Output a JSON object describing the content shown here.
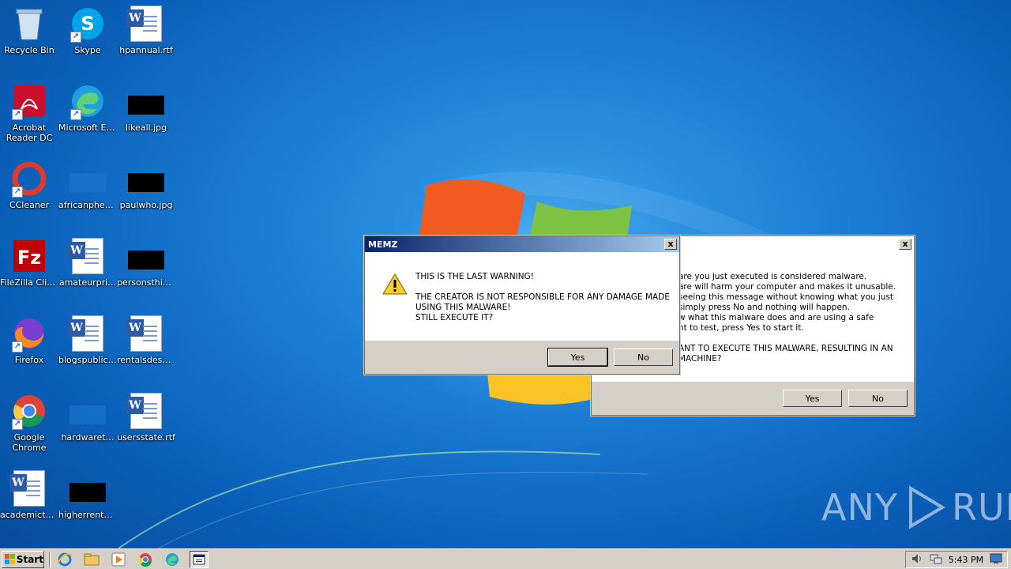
{
  "desktop": {
    "icons": [
      {
        "label": "Recycle Bin",
        "icon": "recycle-bin-icon"
      },
      {
        "label": "Skype",
        "icon": "skype-icon"
      },
      {
        "label": "hpannual.rtf",
        "icon": "word-document-icon"
      },
      {
        "label": "Acrobat Reader DC",
        "icon": "acrobat-icon"
      },
      {
        "label": "Microsoft Edge",
        "icon": "edge-icon"
      },
      {
        "label": "likeall.jpg",
        "icon": "image-thumbnail-icon"
      },
      {
        "label": "CCleaner",
        "icon": "ccleaner-icon"
      },
      {
        "label": "africanphen…",
        "icon": "image-thumbnail-icon"
      },
      {
        "label": "paulwho.jpg",
        "icon": "image-thumbnail-icon"
      },
      {
        "label": "FileZilla Client",
        "icon": "filezilla-icon"
      },
      {
        "label": "amateurpri…",
        "icon": "word-document-icon"
      },
      {
        "label": "personsthin…",
        "icon": "image-thumbnail-icon"
      },
      {
        "label": "Firefox",
        "icon": "firefox-icon"
      },
      {
        "label": "blogspublic.rtf",
        "icon": "word-document-icon"
      },
      {
        "label": "rentalsdescr…",
        "icon": "word-document-icon"
      },
      {
        "label": "Google Chrome",
        "icon": "chrome-icon"
      },
      {
        "label": "hardwaret…",
        "icon": "image-thumbnail-icon"
      },
      {
        "label": "usersstate.rtf",
        "icon": "word-document-icon"
      },
      {
        "label": "academicty…",
        "icon": "word-document-icon"
      },
      {
        "label": "higherrental…",
        "icon": "image-thumbnail-icon"
      }
    ]
  },
  "dialog_front": {
    "title": "MEMZ",
    "close_label": "x",
    "line1": "THIS IS THE LAST WARNING!",
    "line2": "THE CREATOR IS NOT RESPONSIBLE FOR ANY DAMAGE MADE",
    "line3": "USING THIS MALWARE!",
    "line4": "STILL EXECUTE IT?",
    "yes_label": "Yes",
    "no_label": "No",
    "icon": "warning-icon"
  },
  "dialog_back": {
    "close_label": "x",
    "lines": [
      "are you just executed is considered malware.",
      "are will harm your computer and makes it unusable.",
      "seeing this message without knowing what you just",
      "simply press No and nothing will happen.",
      "w what this malware does and are using a safe",
      "nt to test, press Yes to start it.",
      "",
      "ANT TO EXECUTE THIS MALWARE, RESULTING IN AN",
      "MACHINE?"
    ],
    "yes_label": "Yes",
    "no_label": "No"
  },
  "watermark": {
    "left": "ANY",
    "right": "RUN"
  },
  "taskbar": {
    "start_label": "Start",
    "pinned": [
      "ie-icon",
      "explorer-icon",
      "media-player-icon",
      "chrome-icon",
      "edge-icon",
      "memz-window-icon"
    ],
    "clock": "5:43 PM"
  }
}
